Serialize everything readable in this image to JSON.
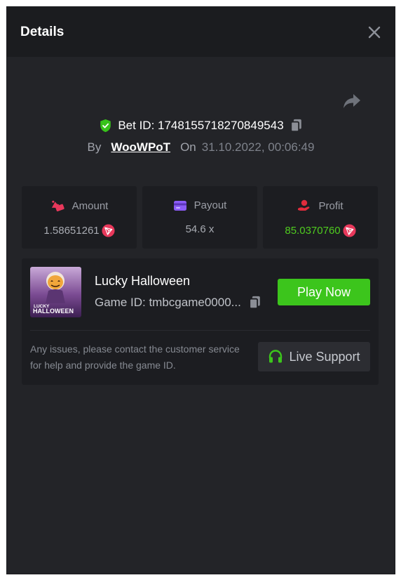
{
  "modal": {
    "title": "Details"
  },
  "bet": {
    "id_text": "Bet ID: 1748155718270849543",
    "by_label": "By",
    "user": "WooWPoT",
    "on_label": "On",
    "date": "31.10.2022, 00:06:49"
  },
  "stats": [
    {
      "label": "Amount",
      "value": "1.58651261",
      "icon": "money-wing-icon",
      "has_coin": true
    },
    {
      "label": "Payout",
      "value": "54.6 x",
      "icon": "card-icon",
      "has_coin": false
    },
    {
      "label": "Profit",
      "value": "85.0370760",
      "icon": "hand-coin-icon",
      "has_coin": true
    }
  ],
  "game": {
    "name": "Lucky Halloween",
    "id_text": "Game ID: tmbcgame0000...",
    "play_label": "Play Now",
    "thumb_lines": [
      "LUCKY",
      "HALLOWEEN"
    ],
    "issue_text": "Any issues, please contact the customer service for help and provide the game ID.",
    "support_label": "Live Support"
  },
  "colors": {
    "accent_green": "#3cc51c",
    "profit_green": "#4fcb1f",
    "trx_red": "#e8385b"
  }
}
